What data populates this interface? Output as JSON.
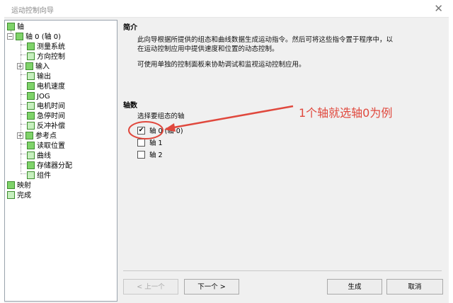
{
  "window": {
    "title": "运动控制向导",
    "close_glyph": "✕"
  },
  "tree": {
    "root": "轴",
    "axis0": "轴 0 (轴 0)",
    "items": [
      "测量系统",
      "方向控制",
      "输入",
      "输出",
      "电机速度",
      "JOG",
      "电机时间",
      "急停时间",
      "反冲补偿",
      "参考点",
      "读取位置",
      "曲线",
      "存储器分配",
      "组件"
    ],
    "mapping": "映射",
    "finish": "完成",
    "collapse_glyph": "−",
    "expand_glyph": "+"
  },
  "intro": {
    "title": "简介",
    "line1": "此向导根据所提供的组态和曲线数据生成运动指令。然后可将这些指令置于程序中，以",
    "line2": "在运动控制应用中提供速度和位置的动态控制。",
    "line3": "可使用单独的控制面板来协助调试和监视运动控制应用。"
  },
  "axes": {
    "title": "轴数",
    "prompt": "选择要组态的轴",
    "options": [
      {
        "label": "轴 0 (轴 0)",
        "checked": true
      },
      {
        "label": "轴 1",
        "checked": false
      },
      {
        "label": "轴 2",
        "checked": false
      }
    ],
    "check_glyph": "✔"
  },
  "annotation": {
    "text": "1个轴就选轴0为例",
    "color": "#e0483d"
  },
  "buttons": {
    "prev": "< 上一个",
    "next": "下一个 >",
    "generate": "生成",
    "cancel": "取消"
  }
}
